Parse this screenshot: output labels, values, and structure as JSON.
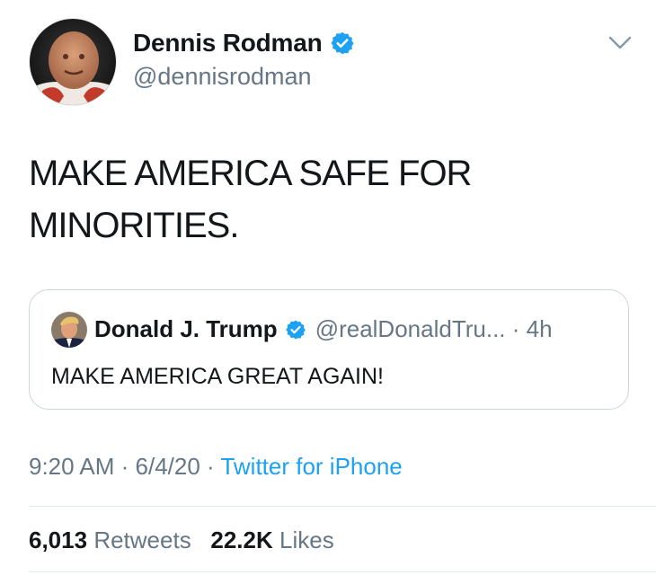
{
  "author": {
    "name": "Dennis Rodman",
    "handle": "@dennisrodman",
    "verified": true,
    "avatar_icon": "profile-photo"
  },
  "tweet": {
    "text": "MAKE AMERICA SAFE FOR MINORITIES."
  },
  "quoted": {
    "name": "Donald J. Trump",
    "handle_time": "@realDonaldTru... · 4h",
    "verified": true,
    "text": "MAKE AMERICA GREAT AGAIN!"
  },
  "meta": {
    "time": "9:20 AM",
    "sep1": " · ",
    "date": "6/4/20",
    "sep2": " · ",
    "source": "Twitter for iPhone"
  },
  "stats": {
    "retweets_count": "6,013",
    "retweets_label": "Retweets",
    "likes_count": "22.2K",
    "likes_label": "Likes"
  },
  "colors": {
    "verified_blue": "#1da1f2",
    "text": "#14171a",
    "secondary": "#657786",
    "border": "#ccd6dd"
  }
}
